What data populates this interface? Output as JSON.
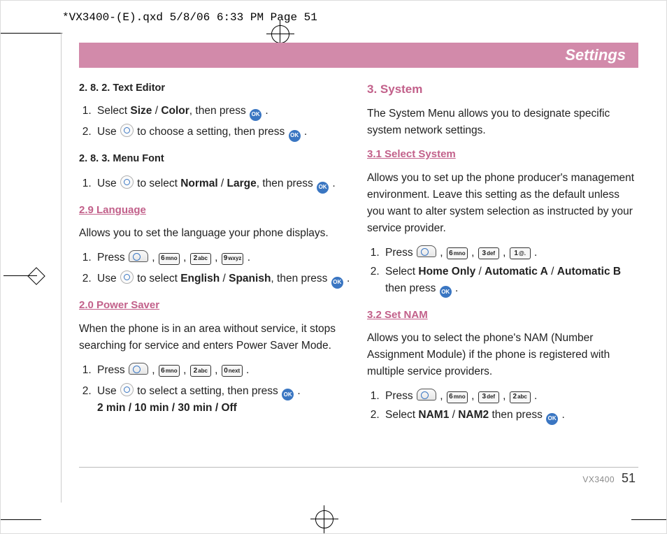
{
  "printslug": "*VX3400-(E).qxd  5/8/06  6:33 PM  Page 51",
  "header": {
    "title": "Settings"
  },
  "keys": {
    "k1": "1",
    "k2": "2",
    "k3": "3",
    "k6": "6",
    "k9": "9",
    "k0": "0",
    "k1s": "@.",
    "k2s": "abc",
    "k3s": "def",
    "k6s": "mno",
    "k9s": "wxyz",
    "k0s": "next",
    "ok": "OK"
  },
  "left": {
    "h282": "2. 8. 2. Text Editor",
    "i282_1a": "Select ",
    "i282_1b": "Size",
    "i282_1c": " / ",
    "i282_1d": "Color",
    "i282_1e": ", then press ",
    "i282_2a": "Use ",
    "i282_2b": " to choose a setting, then press ",
    "h283": "2. 8. 3. Menu Font",
    "i283_1a": "Use ",
    "i283_1b": " to select ",
    "i283_1c": "Normal",
    "i283_1d": " / ",
    "i283_1e": "Large",
    "i283_1f": ", then press ",
    "h29": "2.9 Language",
    "p29": "Allows you to set the language your phone displays.",
    "i29_1a": "Press ",
    "i29_2a": "Use ",
    "i29_2b": " to select ",
    "i29_2c": "English",
    "i29_2d": " / ",
    "i29_2e": "Spanish",
    "i29_2f": ", then press ",
    "h20": "2.0 Power Saver",
    "p20": "When the phone is in an area without service, it stops searching for service and enters Power Saver Mode.",
    "i20_1a": "Press ",
    "i20_2a": "Use ",
    "i20_2b": " to select a setting, then press ",
    "i20_2opts": "2 min / 10 min / 30 min / Off"
  },
  "right": {
    "h3": "3. System",
    "p3": "The System Menu allows you to designate specific system network settings.",
    "h31": "3.1 Select System",
    "p31": "Allows you to set up the phone producer's management environment. Leave this setting as the default unless you want to alter system selection as instructed by your service provider.",
    "i31_1a": "Press ",
    "i31_2a": "Select ",
    "i31_2b": "Home Only",
    "i31_2c": " / ",
    "i31_2d": "Automatic A",
    "i31_2e": " / ",
    "i31_2f": "Automatic B",
    "i31_2g": " then press ",
    "h32": "3.2 Set NAM",
    "p32": "Allows you to select the phone's NAM (Number Assignment Module) if the phone is registered with multiple service providers.",
    "i32_1a": "Press ",
    "i32_2a": "Select ",
    "i32_2b": "NAM1",
    "i32_2c": " / ",
    "i32_2d": "NAM2",
    "i32_2e": " then press "
  },
  "footer": {
    "model": "VX3400",
    "page": "51"
  }
}
